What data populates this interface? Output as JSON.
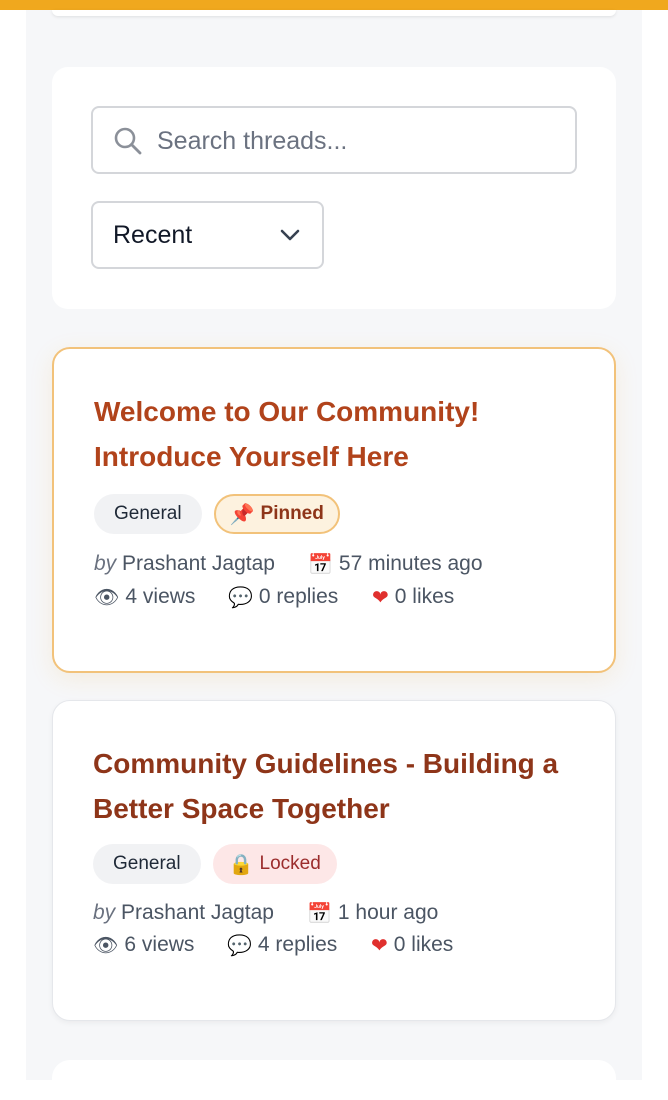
{
  "search": {
    "placeholder": "Search threads..."
  },
  "sort": {
    "selected": "Recent"
  },
  "threads": [
    {
      "title": "Welcome to Our Community! Introduce Yourself Here",
      "category": "General",
      "status_label": "Pinned",
      "status_icon": "pushpin-icon",
      "by_label": "by",
      "author": "Prashant Jagtap",
      "time": "57 minutes ago",
      "views": "4 views",
      "replies": "0 replies",
      "likes": "0 likes"
    },
    {
      "title": "Community Guidelines - Building a Better Space Together",
      "category": "General",
      "status_label": "Locked",
      "status_icon": "lock-icon",
      "by_label": "by",
      "author": "Prashant Jagtap",
      "time": "1 hour ago",
      "views": "6 views",
      "replies": "4 replies",
      "likes": "0 likes"
    }
  ],
  "colors": {
    "accent": "#f0a81e",
    "title": "#b1431b",
    "background": "#f6f7f9"
  }
}
